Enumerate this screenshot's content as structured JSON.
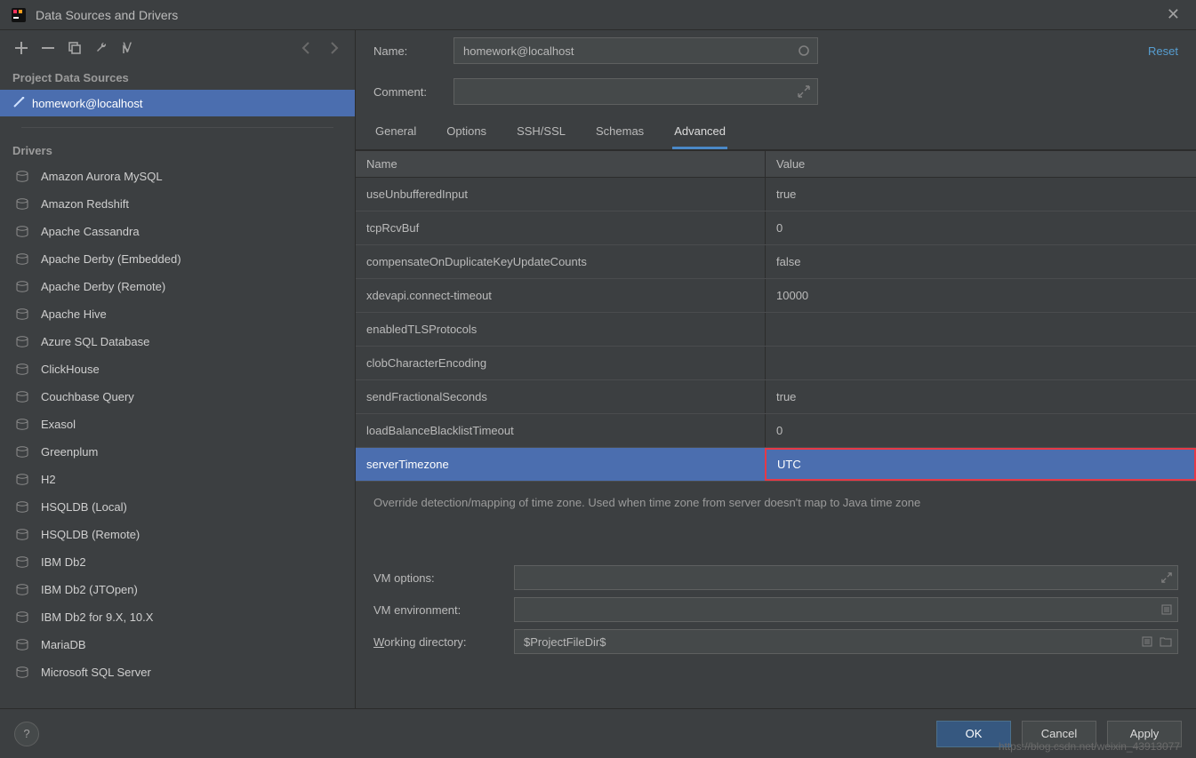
{
  "titlebar": {
    "title": "Data Sources and Drivers"
  },
  "toolbar": {},
  "sidebar": {
    "projectHeader": "Project Data Sources",
    "dataSources": [
      {
        "label": "homework@localhost",
        "selected": true
      }
    ],
    "driversHeader": "Drivers",
    "drivers": [
      {
        "label": "Amazon Aurora MySQL"
      },
      {
        "label": "Amazon Redshift"
      },
      {
        "label": "Apache Cassandra"
      },
      {
        "label": "Apache Derby (Embedded)"
      },
      {
        "label": "Apache Derby (Remote)"
      },
      {
        "label": "Apache Hive"
      },
      {
        "label": "Azure SQL Database"
      },
      {
        "label": "ClickHouse"
      },
      {
        "label": "Couchbase Query"
      },
      {
        "label": "Exasol"
      },
      {
        "label": "Greenplum"
      },
      {
        "label": "H2"
      },
      {
        "label": "HSQLDB (Local)"
      },
      {
        "label": "HSQLDB (Remote)"
      },
      {
        "label": "IBM Db2"
      },
      {
        "label": "IBM Db2 (JTOpen)"
      },
      {
        "label": "IBM Db2 for 9.X, 10.X"
      },
      {
        "label": "MariaDB"
      },
      {
        "label": "Microsoft SQL Server"
      }
    ]
  },
  "form": {
    "nameLabel": "Name:",
    "nameValue": "homework@localhost",
    "commentLabel": "Comment:",
    "commentValue": "",
    "resetLabel": "Reset"
  },
  "tabs": [
    {
      "label": "General"
    },
    {
      "label": "Options"
    },
    {
      "label": "SSH/SSL"
    },
    {
      "label": "Schemas"
    },
    {
      "label": "Advanced",
      "active": true
    }
  ],
  "table": {
    "headers": {
      "name": "Name",
      "value": "Value"
    },
    "rows": [
      {
        "name": "useUnbufferedInput",
        "value": "true"
      },
      {
        "name": "tcpRcvBuf",
        "value": "0"
      },
      {
        "name": "compensateOnDuplicateKeyUpdateCounts",
        "value": "false"
      },
      {
        "name": "xdevapi.connect-timeout",
        "value": "10000"
      },
      {
        "name": "enabledTLSProtocols",
        "value": ""
      },
      {
        "name": "clobCharacterEncoding",
        "value": ""
      },
      {
        "name": "sendFractionalSeconds",
        "value": "true"
      },
      {
        "name": "loadBalanceBlacklistTimeout",
        "value": "0"
      },
      {
        "name": "serverTimezone",
        "value": "UTC",
        "selected": true
      }
    ]
  },
  "description": "Override detection/mapping of time zone. Used when time zone from server doesn't map to Java time zone",
  "bottom": {
    "vmOptionsLabel": "VM options:",
    "vmOptionsValue": "",
    "vmEnvLabel": "VM environment:",
    "vmEnvValue": "",
    "workingDirLabelPrefix": "W",
    "workingDirLabelRest": "orking directory:",
    "workingDirValue": "$ProjectFileDir$"
  },
  "footer": {
    "ok": "OK",
    "cancel": "Cancel",
    "apply": "Apply"
  },
  "watermark": "https://blog.csdn.net/weixin_43913077"
}
